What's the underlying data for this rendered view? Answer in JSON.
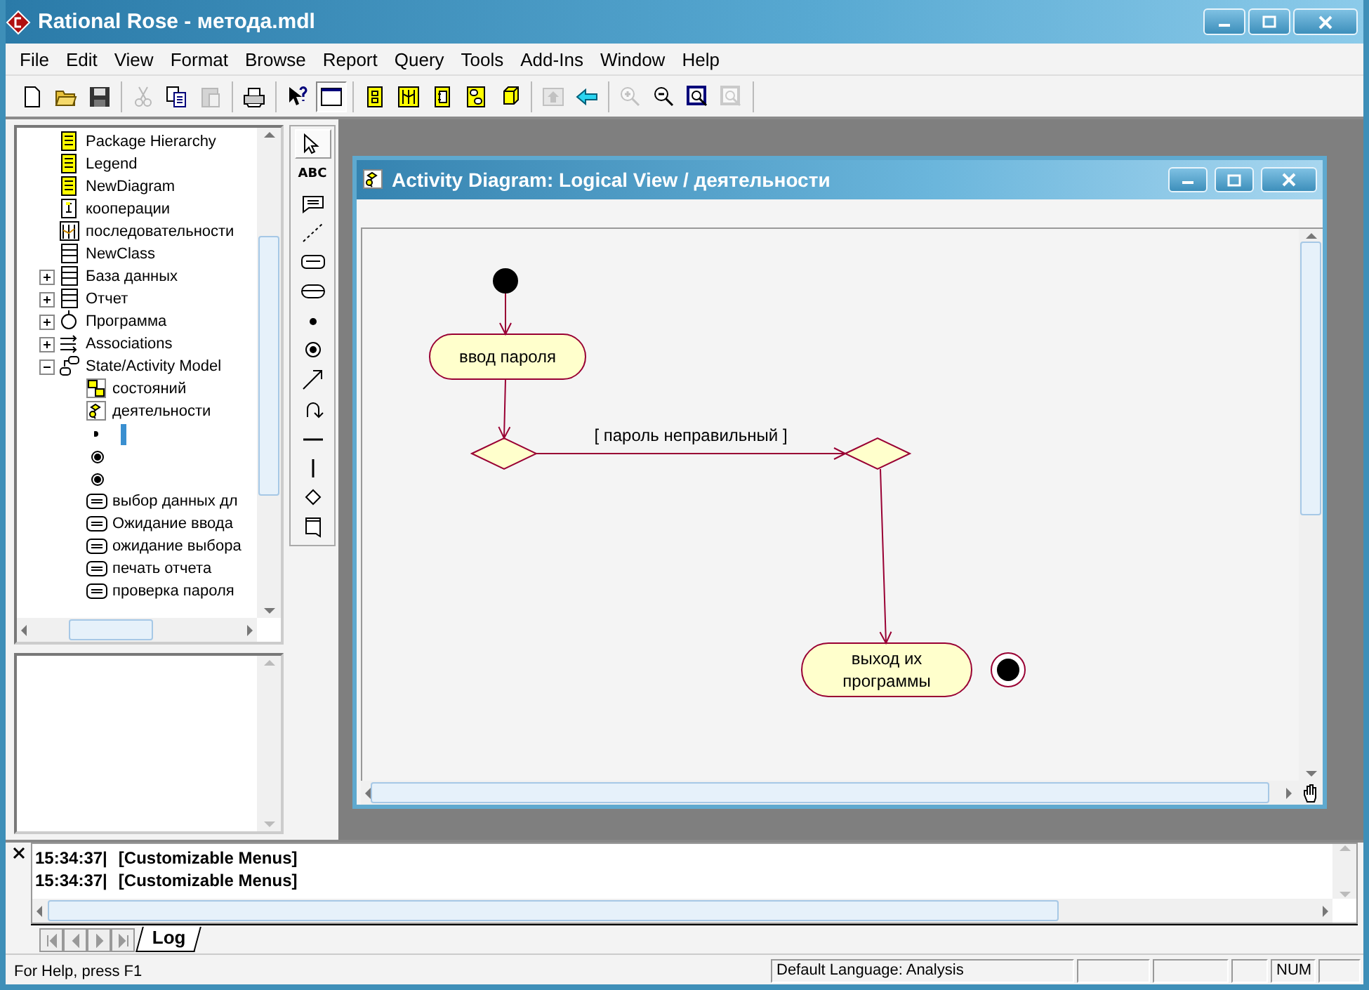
{
  "window": {
    "title": "Rational Rose - метода.mdl"
  },
  "menu": [
    {
      "label": "File"
    },
    {
      "label": "Edit"
    },
    {
      "label": "View"
    },
    {
      "label": "Format"
    },
    {
      "label": "Browse"
    },
    {
      "label": "Report"
    },
    {
      "label": "Query"
    },
    {
      "label": "Tools"
    },
    {
      "label": "Add-Ins"
    },
    {
      "label": "Window"
    },
    {
      "label": "Help"
    }
  ],
  "toolbar": [
    [
      {
        "kind": "new",
        "disabled": false,
        "on": false
      },
      {
        "kind": "open",
        "disabled": false,
        "on": false
      },
      {
        "kind": "save",
        "disabled": false,
        "on": false
      }
    ],
    [
      {
        "kind": "cut",
        "disabled": true,
        "on": false
      },
      {
        "kind": "copy",
        "disabled": false,
        "on": false
      },
      {
        "kind": "paste",
        "disabled": true,
        "on": false
      }
    ],
    [
      {
        "kind": "print",
        "disabled": false,
        "on": false
      }
    ],
    [
      {
        "kind": "context-help",
        "disabled": false,
        "on": false
      },
      {
        "kind": "view-doc",
        "disabled": false,
        "on": true
      }
    ],
    [
      {
        "kind": "diagram",
        "disabled": false,
        "on": false
      },
      {
        "kind": "sequence",
        "disabled": false,
        "on": false
      },
      {
        "kind": "component",
        "disabled": false,
        "on": false
      },
      {
        "kind": "statechart",
        "disabled": false,
        "on": false
      },
      {
        "kind": "deployment",
        "disabled": false,
        "on": false
      }
    ],
    [
      {
        "kind": "parent",
        "disabled": true,
        "on": false
      },
      {
        "kind": "previous",
        "disabled": false,
        "on": false
      }
    ],
    [
      {
        "kind": "zoom-in",
        "disabled": true,
        "on": false
      },
      {
        "kind": "zoom-out",
        "disabled": false,
        "on": false
      },
      {
        "kind": "fit",
        "disabled": false,
        "on": false
      },
      {
        "kind": "undo-fit",
        "disabled": true,
        "on": false
      }
    ]
  ],
  "browser": {
    "items": [
      {
        "kind": "diagram",
        "label": "Package Hierarchy"
      },
      {
        "kind": "diagram",
        "label": "Legend"
      },
      {
        "kind": "diagram",
        "label": "NewDiagram"
      },
      {
        "kind": "collaboration",
        "label": "кооперации"
      },
      {
        "kind": "sequence",
        "label": "последовательности"
      },
      {
        "kind": "class",
        "label": "NewClass"
      },
      {
        "kind": "class",
        "label": "База данных",
        "expanded": false
      },
      {
        "kind": "class",
        "label": "Отчет",
        "expanded": false
      },
      {
        "kind": "interface",
        "label": "Программа",
        "expanded": false
      },
      {
        "kind": "associations",
        "label": "Associations",
        "expanded": false
      },
      {
        "kind": "state-model",
        "label": "State/Activity Model",
        "expanded": true,
        "children": [
          {
            "kind": "statechart",
            "label": "состояний"
          },
          {
            "kind": "activity-diagram",
            "label": "деятельности"
          },
          {
            "kind": "start",
            "editing": true
          },
          {
            "kind": "end"
          },
          {
            "kind": "end"
          },
          {
            "kind": "activity",
            "label": "выбор данных дл"
          },
          {
            "kind": "activity",
            "label": "Ожидание ввода"
          },
          {
            "kind": "activity",
            "label": "ожидание выбора"
          },
          {
            "kind": "activity",
            "label": "печать отчета"
          },
          {
            "kind": "activity",
            "label": "проверка пароля"
          }
        ]
      }
    ]
  },
  "toolbox": [
    {
      "kind": "selection",
      "selected": true
    },
    {
      "kind": "text",
      "label": "ABC",
      "selected": false
    },
    {
      "kind": "note",
      "selected": false
    },
    {
      "kind": "anchor",
      "selected": false
    },
    {
      "kind": "state",
      "selected": false
    },
    {
      "kind": "activity",
      "selected": false
    },
    {
      "kind": "start",
      "selected": false
    },
    {
      "kind": "end",
      "selected": false
    },
    {
      "kind": "transition",
      "selected": false
    },
    {
      "kind": "self-transition",
      "selected": false
    },
    {
      "kind": "horizontal-sync",
      "selected": false
    },
    {
      "kind": "vertical-sync",
      "selected": false
    },
    {
      "kind": "decision",
      "selected": false
    },
    {
      "kind": "swimlane",
      "selected": false
    }
  ],
  "diagram_window": {
    "title": "Activity Diagram: Logical View / деятельности",
    "nodes": [
      {
        "kind": "start"
      },
      {
        "kind": "activity",
        "label": "ввод пароля"
      },
      {
        "kind": "decision"
      },
      {
        "kind": "decision"
      },
      {
        "kind": "activity",
        "label": "выход их программы"
      },
      {
        "kind": "end"
      }
    ],
    "transitions": [
      {
        "kind": "flow"
      },
      {
        "kind": "flow"
      },
      {
        "kind": "flow",
        "guard": "[ пароль неправильный ]"
      },
      {
        "kind": "flow"
      }
    ]
  },
  "log": {
    "entries": [
      {
        "time": "15:34:37|",
        "text": "[Customizable Menus]"
      },
      {
        "time": "15:34:37|",
        "text": "[Customizable Menus]"
      }
    ],
    "tabs": [
      {
        "label": "Log",
        "selected": true
      }
    ]
  },
  "status_bar": {
    "help": "For Help, press F1",
    "language": "Default Language: Analysis",
    "indicator": "NUM"
  }
}
